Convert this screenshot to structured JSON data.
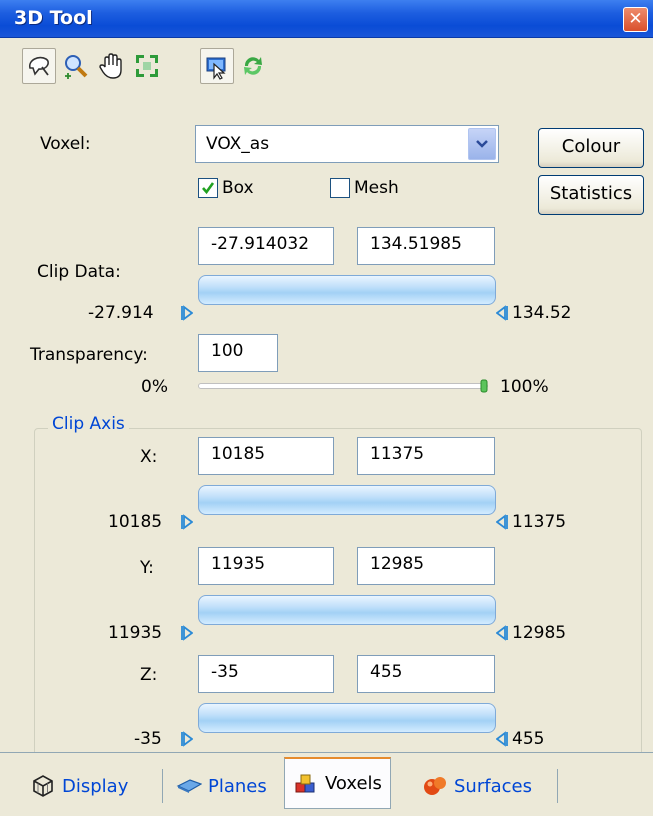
{
  "window": {
    "title": "3D Tool"
  },
  "voxel": {
    "label": "Voxel:",
    "selected": "VOX_as"
  },
  "buttons": {
    "colour": "Colour",
    "statistics": "Statistics"
  },
  "checkboxes": {
    "box": "Box",
    "mesh": "Mesh"
  },
  "clip_data": {
    "label": "Clip Data:",
    "min_value": "-27.914032",
    "max_value": "134.51985",
    "min_label": "-27.914",
    "max_label": "134.52"
  },
  "transparency": {
    "label": "Transparency:",
    "value": "100",
    "min_label": "0%",
    "max_label": "100%"
  },
  "clip_axis": {
    "title": "Clip Axis",
    "x": {
      "label": "X:",
      "min": "10185",
      "max": "11375",
      "min_label": "10185",
      "max_label": "11375"
    },
    "y": {
      "label": "Y:",
      "min": "11935",
      "max": "12985",
      "min_label": "11935",
      "max_label": "12985"
    },
    "z": {
      "label": "Z:",
      "min": "-35",
      "max": "455",
      "min_label": "-35",
      "max_label": "455"
    }
  },
  "tabs": [
    {
      "label": "Display",
      "icon": "cube-outline-icon"
    },
    {
      "label": "Planes",
      "icon": "plane-icon"
    },
    {
      "label": "Voxels",
      "icon": "voxels-icon"
    },
    {
      "label": "Surfaces",
      "icon": "surface-sphere-icon"
    }
  ],
  "toolbar": [
    "lasso-rotate-icon",
    "zoom-icon",
    "pan-hand-icon",
    "fit-view-icon",
    "pick-icon",
    "refresh-icon"
  ],
  "colors": {
    "title_bar": "#0a4cd6",
    "panel": "#ece9d8",
    "slider_fill": "#a3d1f5",
    "group_title": "#0046d5"
  }
}
